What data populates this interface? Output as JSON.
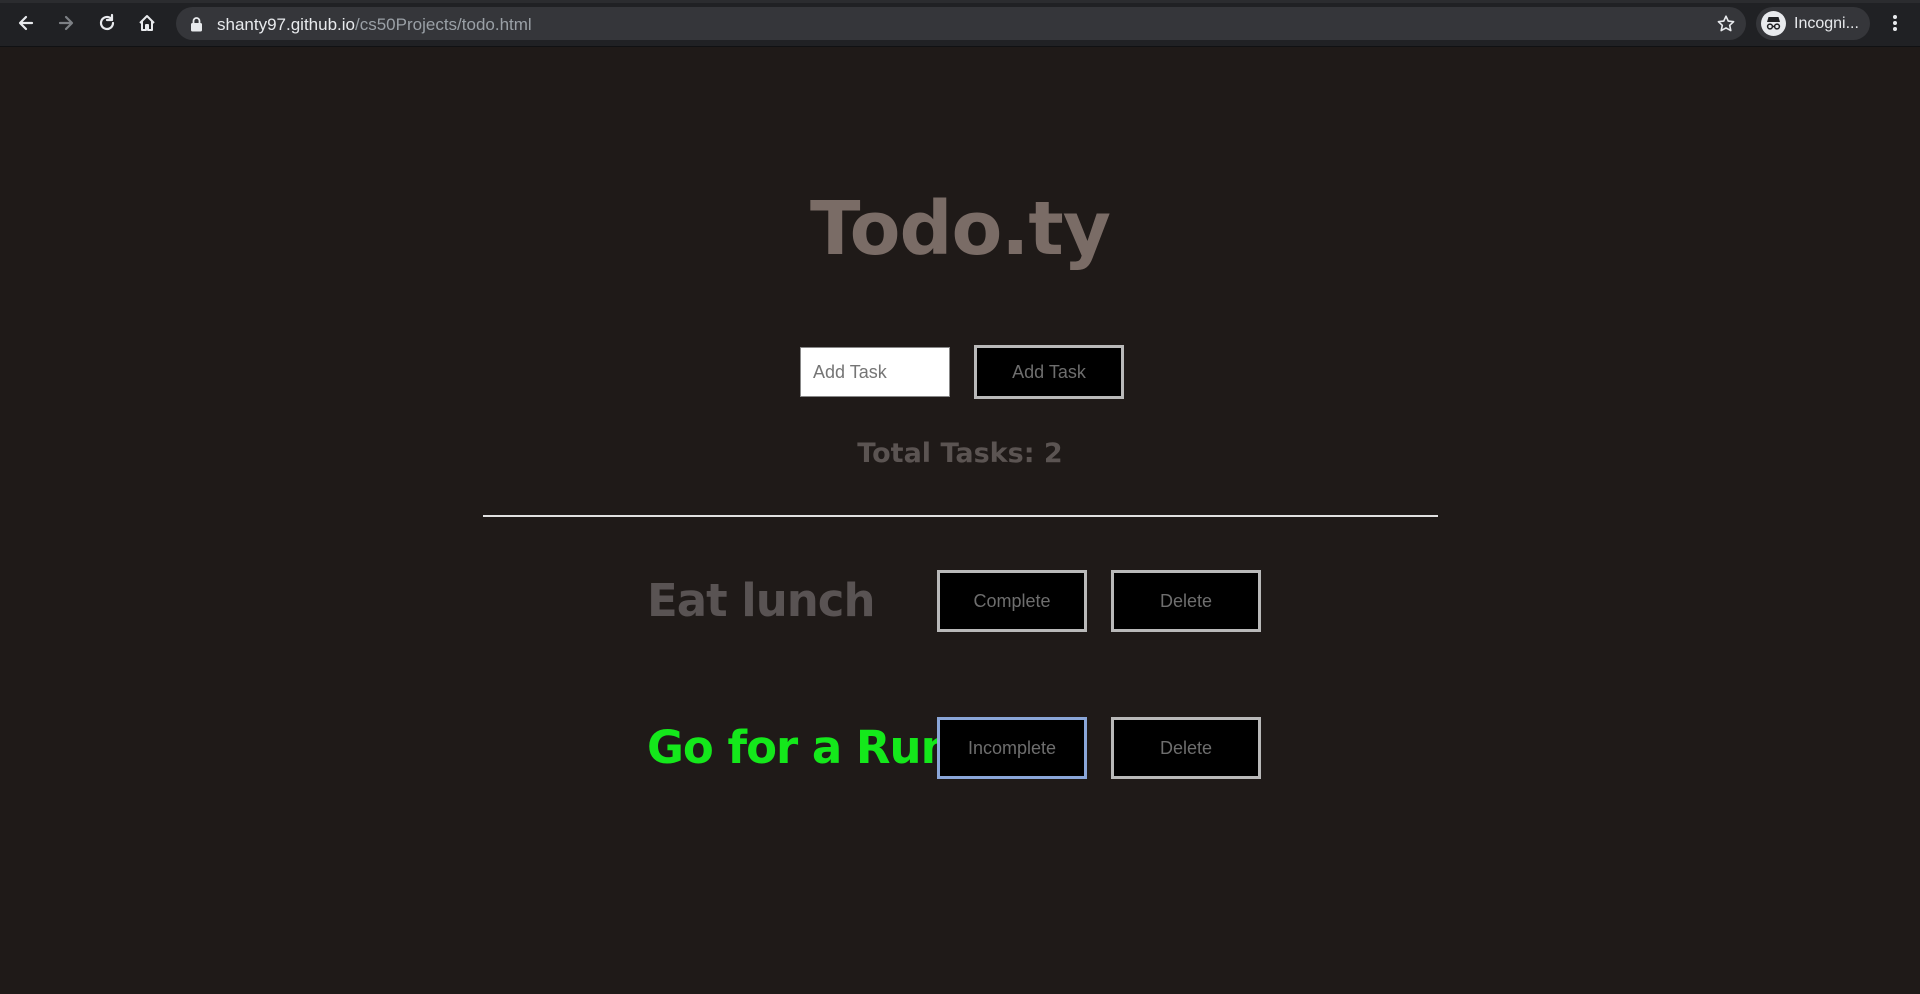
{
  "browser": {
    "url_host": "shanty97.github.io",
    "url_path": "/cs50Projects/todo.html",
    "profile_label": "Incogni..."
  },
  "app": {
    "title": "Todo.ty",
    "input_placeholder": "Add Task",
    "add_button_label": "Add Task",
    "total_tasks_text": "Total Tasks: 2"
  },
  "tasks": [
    {
      "name": "Eat lunch",
      "toggle_label": "Complete",
      "delete_label": "Delete",
      "color": "#595353"
    },
    {
      "name": "Go for a Run",
      "toggle_label": "Incomplete",
      "delete_label": "Delete",
      "color": "#14e81b"
    }
  ],
  "colors": {
    "page_background": "#1f1a18",
    "title": "#7a6c66",
    "completed_task": "#14e81b"
  }
}
